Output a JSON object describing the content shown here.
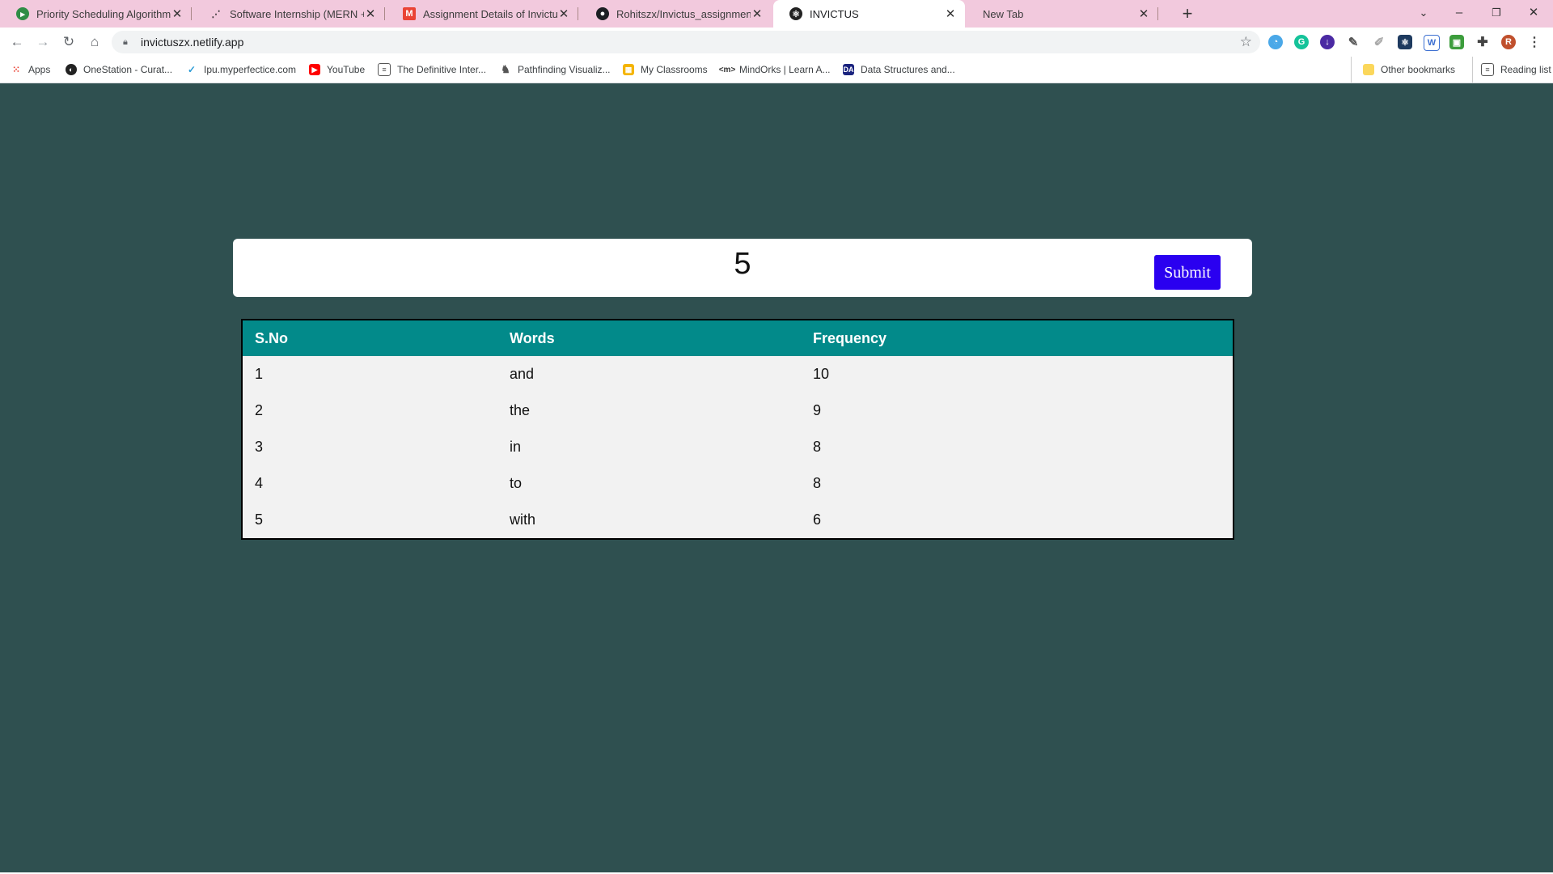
{
  "browser": {
    "tabs": [
      {
        "title": "Priority Scheduling Algorithm | C",
        "icon": "green-circle-icon",
        "active": false
      },
      {
        "title": "Software Internship (MERN + Re",
        "icon": "network-icon",
        "active": false
      },
      {
        "title": "Assignment Details of Invictus. -",
        "icon": "gmail-icon",
        "active": false
      },
      {
        "title": "Rohitszx/Invictus_assignment",
        "icon": "github-icon",
        "active": false
      },
      {
        "title": "INVICTUS",
        "icon": "react-icon",
        "active": true
      },
      {
        "title": "New Tab",
        "icon": "",
        "active": false
      }
    ],
    "url": "invictuszx.netlify.app",
    "bookmarks": [
      {
        "label": "Apps",
        "icon": "apps-grid-icon"
      },
      {
        "label": "OneStation - Curat...",
        "icon": "onestation-icon"
      },
      {
        "label": "Ipu.myperfectice.com",
        "icon": "perfectice-icon"
      },
      {
        "label": "YouTube",
        "icon": "youtube-icon"
      },
      {
        "label": "The Definitive Inter...",
        "icon": "doc-icon"
      },
      {
        "label": "Pathfinding Visualiz...",
        "icon": "pathfinding-icon"
      },
      {
        "label": "My Classrooms",
        "icon": "classroom-icon"
      },
      {
        "label": "MindOrks | Learn A...",
        "icon": "mindorks-icon"
      },
      {
        "label": "Data Structures and...",
        "icon": "gfg-icon"
      }
    ],
    "other_bookmarks": "Other bookmarks",
    "reading_list": "Reading list"
  },
  "page": {
    "input_value": "5",
    "submit_label": "Submit",
    "colors": {
      "background": "#2f5050",
      "header": "#028a8a",
      "button": "#2a00f0"
    }
  },
  "table": {
    "headers": [
      "S.No",
      "Words",
      "Frequency"
    ],
    "rows": [
      [
        "1",
        "and",
        "10"
      ],
      [
        "2",
        "the",
        "9"
      ],
      [
        "3",
        "in",
        "8"
      ],
      [
        "4",
        "to",
        "8"
      ],
      [
        "5",
        "with",
        "6"
      ]
    ]
  }
}
